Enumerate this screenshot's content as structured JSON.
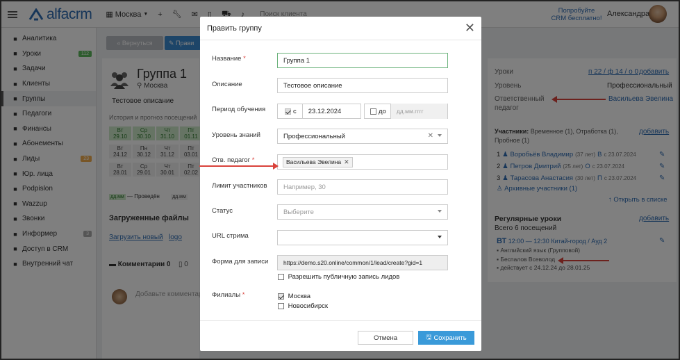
{
  "topbar": {
    "logo_text": "alfacrm",
    "branch_label": "Москва",
    "search_placeholder": "Поиск клиента",
    "promo_line1": "Попробуйте",
    "promo_line2": "CRM бесплатно!",
    "user_name": "Александра"
  },
  "sidebar": {
    "items": [
      {
        "label": "Аналитика",
        "icon": "chart-icon"
      },
      {
        "label": "Уроки",
        "icon": "calendar-icon",
        "badge": "112",
        "badge_color": "#5cb85c"
      },
      {
        "label": "Задачи",
        "icon": "tasks-icon"
      },
      {
        "label": "Клиенты",
        "icon": "user-icon"
      },
      {
        "label": "Группы",
        "icon": "group-icon"
      },
      {
        "label": "Педагоги",
        "icon": "graduation-icon"
      },
      {
        "label": "Финансы",
        "icon": "money-icon"
      },
      {
        "label": "Абонементы",
        "icon": "subscription-icon"
      },
      {
        "label": "Лиды",
        "icon": "leads-icon",
        "badge": "23",
        "badge_color": "#f0ad4e"
      },
      {
        "label": "Юр. лица",
        "icon": "building-icon"
      },
      {
        "label": "Podpislon",
        "icon": "doc-icon"
      },
      {
        "label": "Wazzup",
        "icon": "whatsapp-icon"
      },
      {
        "label": "Звонки",
        "icon": "phone-icon"
      },
      {
        "label": "Информер",
        "icon": "informer-icon",
        "badge": "3",
        "badge_color": "#aaaaaa"
      },
      {
        "label": "Доступ в CRM",
        "icon": "lock-icon"
      },
      {
        "label": "Внутренний чат",
        "icon": "chat-icon"
      }
    ]
  },
  "page": {
    "back_label": "« Вернуться",
    "edit_label": "✎ Прави",
    "group_title": "Группа 1",
    "group_city": "Москва",
    "description": "Тестовое описание",
    "history_label": "История и прогноз посещений",
    "calendar": [
      [
        "Вт",
        "29.10",
        "g"
      ],
      [
        "Ср",
        "30.10",
        "g"
      ],
      [
        "Чт",
        "31.10",
        "g"
      ],
      [
        "Пт",
        "01.11",
        "g"
      ],
      [
        "Вт",
        "24.12",
        "w"
      ],
      [
        "Пн",
        "30.12",
        "w"
      ],
      [
        "Чт",
        "31.12",
        "w"
      ],
      [
        "Пт",
        "03.01",
        "w"
      ],
      [
        "Вт",
        "28.01",
        "w"
      ],
      [
        "Ср",
        "29.01",
        "w"
      ],
      [
        "Чт",
        "30.01",
        "w"
      ],
      [
        "Пт",
        "02.02",
        "w"
      ]
    ],
    "legend_square": "дд.мм",
    "legend_text": "— Проведён",
    "legend_square2": "дд.мм",
    "files_title": "Загруженные файлы",
    "upload_link": "Загрузить новый",
    "logo_file": "logo",
    "comments_tab": "Комментарии 0",
    "files_tab": "0",
    "comment_placeholder": "Добавьте комментар"
  },
  "right_panel": {
    "lessons_label": "Уроки",
    "lessons_value": "п 22 / ф 14 / о 0",
    "add_label": "добавить",
    "level_label": "Уровень",
    "level_value": "Профессиональный",
    "teacher_label_1": "Ответственный",
    "teacher_label_2": "педагог",
    "teacher_value": "Васильева Эвелина",
    "participants_title": "Участники:",
    "participants_detail": "Временное (1), Отработка (1),",
    "participants_detail2": "Пробное (1)",
    "members": [
      {
        "num": "1",
        "name": "Воробьёв Владимир",
        "age": "(37 лет)",
        "type": "В",
        "since": "с 23.07.2024"
      },
      {
        "num": "2",
        "name": "Петров Дмитрий",
        "age": "(25 лет)",
        "type": "О",
        "since": "с 23.07.2024"
      },
      {
        "num": "3",
        "name": "Тарасова Анастасия",
        "age": "(30 лет)",
        "type": "П",
        "since": "с 23.07.2024"
      }
    ],
    "archive_link": "Архивные участники (1)",
    "open_list": "↑ Открыть в списке",
    "regular_title": "Регулярные уроки",
    "regular_sub": "Всего 6 посещений",
    "regular_add": "добавить",
    "lesson_day": "ВТ",
    "lesson_time": "12:00 — 12:30",
    "lesson_room": "Китай-город / Ауд 2",
    "lesson_subject": "Английский язык (Групповой)",
    "lesson_teacher": "Беспалов Всеволод",
    "lesson_period": "действует с 24.12.24 до 28.01.25"
  },
  "modal": {
    "title": "Править группу",
    "name_label": "Название",
    "name_value": "Группа 1",
    "desc_label": "Описание",
    "desc_value": "Тестовое описание",
    "period_label": "Период обучения",
    "from_label": "с",
    "from_value": "23.12.2024",
    "to_label": "до",
    "to_placeholder": "дд.мм.гггг",
    "level_label": "Уровень знаний",
    "level_value": "Профессиональный",
    "teacher_label": "Отв. педагог",
    "teacher_tag": "Васильева Эвелина",
    "limit_label": "Лимит участников",
    "limit_placeholder": "Например, 30",
    "status_label": "Статус",
    "status_placeholder": "Выберите",
    "stream_label": "URL стрима",
    "form_label": "Форма для записи",
    "form_value": "https://demo.s20.online/common/1/lead/create?gid=1",
    "public_label": "Разрешить публичную запись лидов",
    "branches_label": "Филиалы",
    "branch_moscow": "Москва",
    "branch_nsk": "Новосибирск",
    "cancel_label": "Отмена",
    "save_label": "Сохранить"
  }
}
